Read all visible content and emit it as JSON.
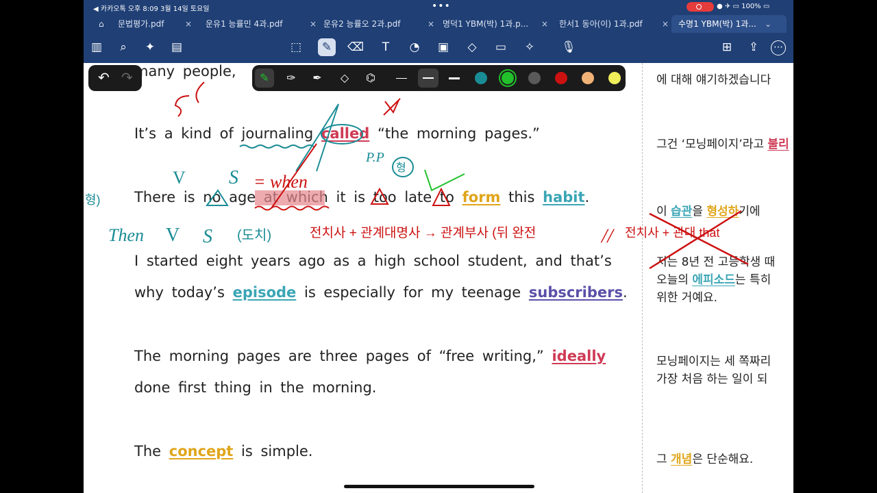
{
  "status": {
    "left": "◀ 카카오톡  오후 8:09   3월 14일 토요일",
    "right": "● ✈ ▭ 100% ▭"
  },
  "tabs": [
    {
      "label": "문법평가.pdf"
    },
    {
      "label": "운유1 능률민 4과.pdf"
    },
    {
      "label": "운유2 능률오 2과.pdf"
    },
    {
      "label": "명덕1 YBM(박) 1과.p..."
    },
    {
      "label": "한서1 동아(이) 1과.pdf"
    },
    {
      "label": "수명1 YBM(박) 1과..."
    }
  ],
  "icons": {
    "tab_close": "×",
    "tab_dropdown": "⌄",
    "home": "⌂",
    "sidebar": "▥",
    "search": "⌕",
    "ai": "✦",
    "outline": "▤",
    "select": "⬚",
    "pencil": "✎",
    "eraser": "⌫",
    "text": "T",
    "shapes": "◔",
    "image": "▣",
    "elements": "◇",
    "sticky": "▭",
    "laser": "✧",
    "mic": "🎙",
    "add_page": "⊞",
    "share": "⇪",
    "more": "⋯",
    "undo": "↶",
    "redo": "↷"
  },
  "doc": {
    "line1": "many people,",
    "line2_a": "It’s a kind of",
    "line2_b": "journaling",
    "line2_c": "called",
    "line2_d": "“the morning pages.”",
    "line3_a": "There is no age at which it is too late to",
    "line3_form": "form",
    "line3_this": "this",
    "line3_habit": "habit",
    "line3_end": ".",
    "line4": "I started eight years ago as a high school student, and that’s",
    "line5_a": "why today’s",
    "line5_episode": "episode",
    "line5_b": "is especially for my teenage",
    "line5_subs": "subscribers",
    "line5_end": ".",
    "line6_a": "The morning pages are three pages of “free writing,”",
    "line6_ideally": "ideally",
    "line7": "done first thing in the morning.",
    "line8_a": "The",
    "line8_concept": "concept",
    "line8_b": "is simple."
  },
  "korean": {
    "k0": "에 대해 얘기하겠습니다",
    "k1_a": "그건 ‘모닝페이지’라고",
    "k1_b": "불리",
    "k2_a": "이",
    "k2_b": "습관",
    "k2_c": "을",
    "k2_d": "형성하",
    "k2_e": "기에",
    "k3": "저는 8년 전 고등학생 때",
    "k4_a": "오늘의",
    "k4_b": "에피소드",
    "k4_c": "는 특히",
    "k5": "위한 거예요.",
    "k6": "모닝페이지는 세 쪽짜리",
    "k7": "가장 처음 하는 일이 되",
    "k8_a": "그",
    "k8_b": "개념",
    "k8_c": "은 단순해요."
  },
  "annotations": {
    "s1": "S",
    "when": "= when",
    "pp": "P.P",
    "circ": "형",
    "v": "V",
    "s2": "S",
    "then": "Then",
    "v2": "V",
    "s3": "S",
    "paren": "(도치)",
    "rule": "전치사 + 관계대명사 → 관계부사 (뒤 완전",
    "slashes": "//",
    "x_note": "전치사 + 관대 that",
    "left_edge": "형)"
  },
  "colors": [
    "#1a8c95",
    "#22c02b",
    "#5a5a5a",
    "#cc1111",
    "#f1b277",
    "#f0ee5a"
  ]
}
